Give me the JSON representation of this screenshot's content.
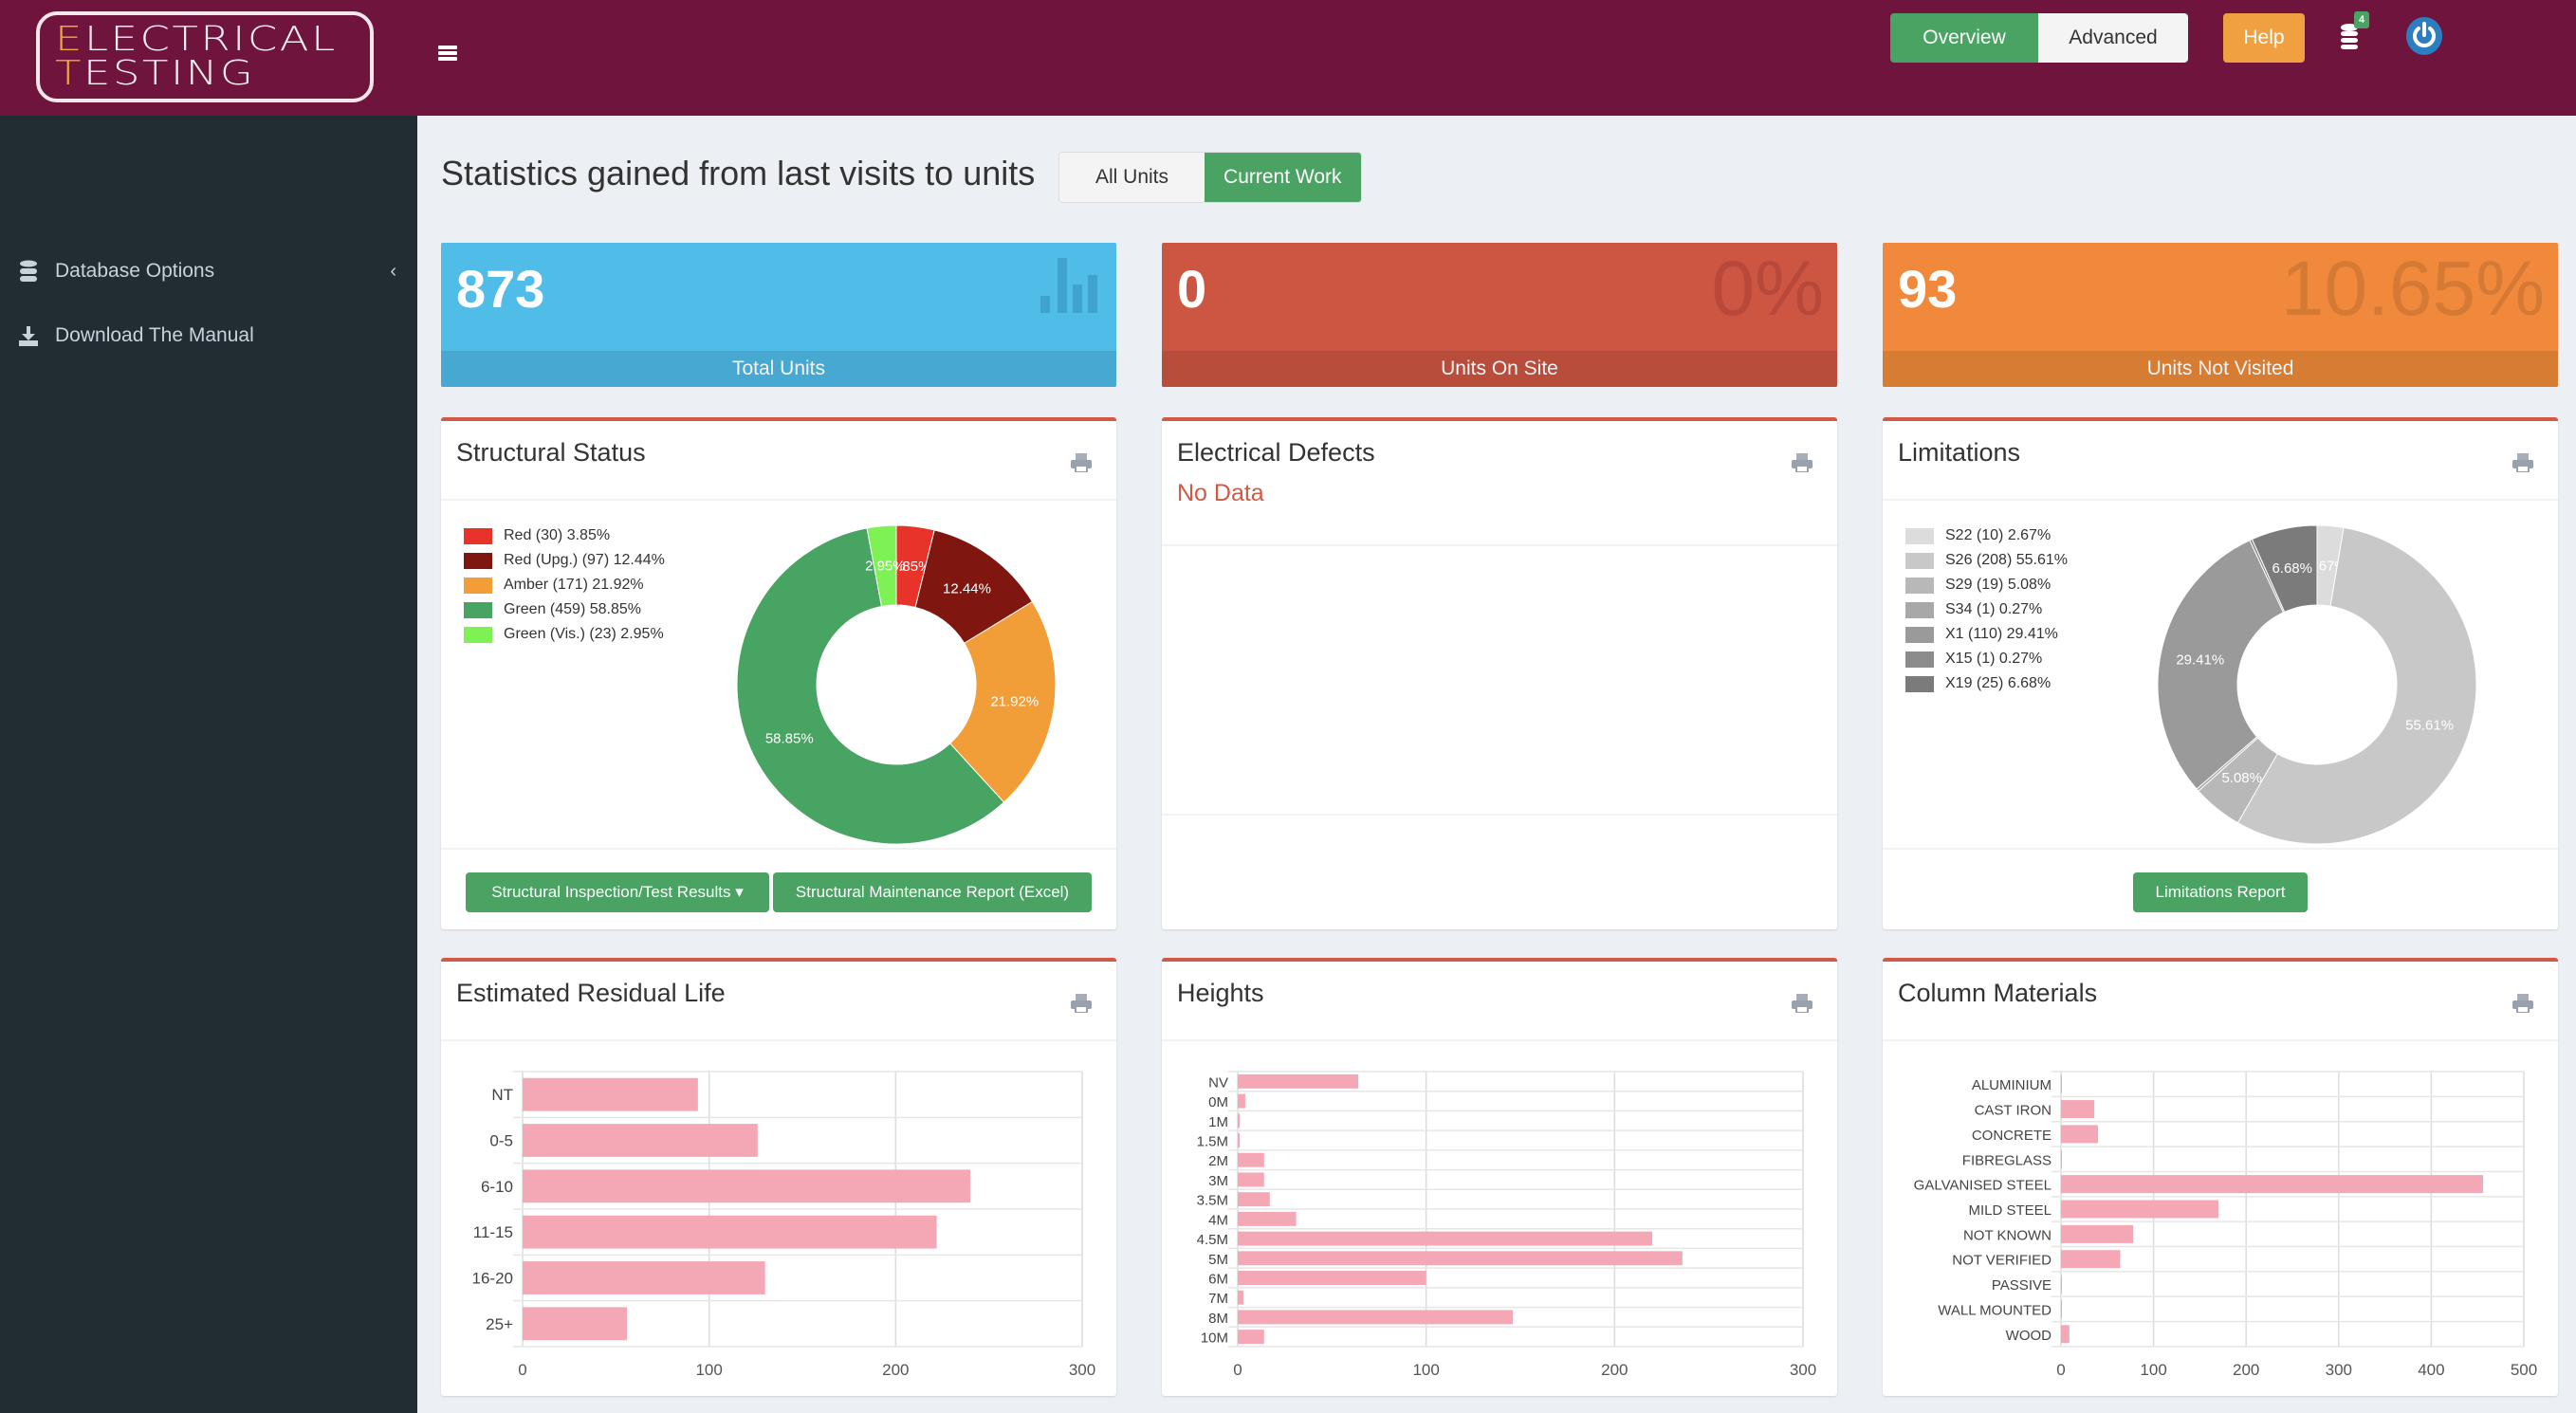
{
  "header": {
    "logo_line1_first": "E",
    "logo_line1_rest": "LECTRICAL",
    "logo_line2_first": "T",
    "logo_line2_rest": "ESTING",
    "overview_label": "Overview",
    "advanced_label": "Advanced",
    "help_label": "Help",
    "db_badge_count": "4"
  },
  "sidebar": {
    "items": [
      {
        "label": "Database Options",
        "icon": "database-icon"
      },
      {
        "label": "Download The Manual",
        "icon": "download-icon"
      }
    ]
  },
  "main": {
    "title": "Statistics gained from last visits to units",
    "toggle": {
      "all_units": "All Units",
      "current_work": "Current Work"
    },
    "stats": [
      {
        "value": "873",
        "label": "Total Units",
        "percent": ""
      },
      {
        "value": "0",
        "label": "Units On Site",
        "percent": "0%"
      },
      {
        "value": "93",
        "label": "Units Not Visited",
        "percent": "10.65%"
      }
    ],
    "panels": {
      "structural": {
        "title": "Structural Status",
        "btn1": "Structural Inspection/Test Results",
        "btn2": "Structural Maintenance Report (Excel)"
      },
      "electrical": {
        "title": "Electrical Defects",
        "no_data": "No Data"
      },
      "limitations": {
        "title": "Limitations",
        "btn": "Limitations Report"
      },
      "residual": {
        "title": "Estimated Residual Life"
      },
      "heights": {
        "title": "Heights"
      },
      "columns": {
        "title": "Column Materials"
      }
    }
  },
  "colors": {
    "header": "#6f153d",
    "accent_green": "#4aa362",
    "bar_pink": "#f4a7b5",
    "panel_top": "#d05a45"
  },
  "chart_data": [
    {
      "type": "pie",
      "id": "structural",
      "title": "Structural Status",
      "donut": true,
      "labels": [
        "Red (30) 3.85%",
        "Red (Upg.) (97) 12.44%",
        "Amber (171) 21.92%",
        "Green (459) 58.85%",
        "Green (Vis.) (23) 2.95%"
      ],
      "values": [
        30,
        97,
        171,
        459,
        23
      ],
      "percent_labels": [
        "3.85%",
        "12.44%",
        "21.92%",
        "58.85%",
        "2.95%"
      ],
      "colors": [
        "#e8332a",
        "#7f1710",
        "#f19e38",
        "#48a462",
        "#7ef254"
      ],
      "legend": "top-left"
    },
    {
      "type": "pie",
      "id": "limitations",
      "title": "Limitations",
      "donut": true,
      "labels": [
        "S22 (10) 2.67%",
        "S26 (208) 55.61%",
        "S29 (19) 5.08%",
        "S34 (1) 0.27%",
        "X1 (110) 29.41%",
        "X15 (1) 0.27%",
        "X19 (25) 6.68%"
      ],
      "values": [
        10,
        208,
        19,
        1,
        110,
        1,
        25
      ],
      "percent_labels": [
        "2.67%",
        "55.61%",
        "5.08%",
        "",
        "29.41%",
        "",
        "6.68%"
      ],
      "colors": [
        "#dcdcdc",
        "#c8c8c8",
        "#b8b8b8",
        "#a8a8a8",
        "#9a9a9a",
        "#8c8c8c",
        "#7b7b7b"
      ],
      "legend": "top-left"
    },
    {
      "type": "bar",
      "orientation": "horizontal",
      "id": "residual",
      "title": "Estimated Residual Life",
      "categories": [
        "NT",
        "0-5",
        "6-10",
        "11-15",
        "16-20",
        "25+"
      ],
      "values": [
        94,
        126,
        240,
        222,
        130,
        56
      ],
      "xlim": [
        0,
        300
      ],
      "xticks": [
        0,
        100,
        200,
        300
      ],
      "grid": true
    },
    {
      "type": "bar",
      "orientation": "horizontal",
      "id": "heights",
      "title": "Heights",
      "categories": [
        "NV",
        "0M",
        "1M",
        "1.5M",
        "2M",
        "3M",
        "3.5M",
        "4M",
        "4.5M",
        "5M",
        "6M",
        "7M",
        "8M",
        "10M"
      ],
      "values": [
        64,
        4,
        1,
        1,
        14,
        14,
        17,
        31,
        220,
        236,
        100,
        3,
        146,
        14
      ],
      "xlim": [
        0,
        300
      ],
      "xticks": [
        0,
        100,
        200,
        300
      ],
      "grid": true
    },
    {
      "type": "bar",
      "orientation": "horizontal",
      "id": "columns",
      "title": "Column Materials",
      "categories": [
        "ALUMINIUM",
        "CAST IRON",
        "CONCRETE",
        "FIBREGLASS",
        "GALVANISED STEEL",
        "MILD STEEL",
        "NOT KNOWN",
        "NOT VERIFIED",
        "PASSIVE",
        "WALL MOUNTED",
        "WOOD"
      ],
      "values": [
        0.3,
        36,
        40,
        0.3,
        456,
        170,
        78,
        64,
        0.3,
        0.3,
        9
      ],
      "xlim": [
        0,
        500
      ],
      "xticks": [
        0,
        100,
        200,
        300,
        400,
        500
      ],
      "grid": true
    }
  ]
}
